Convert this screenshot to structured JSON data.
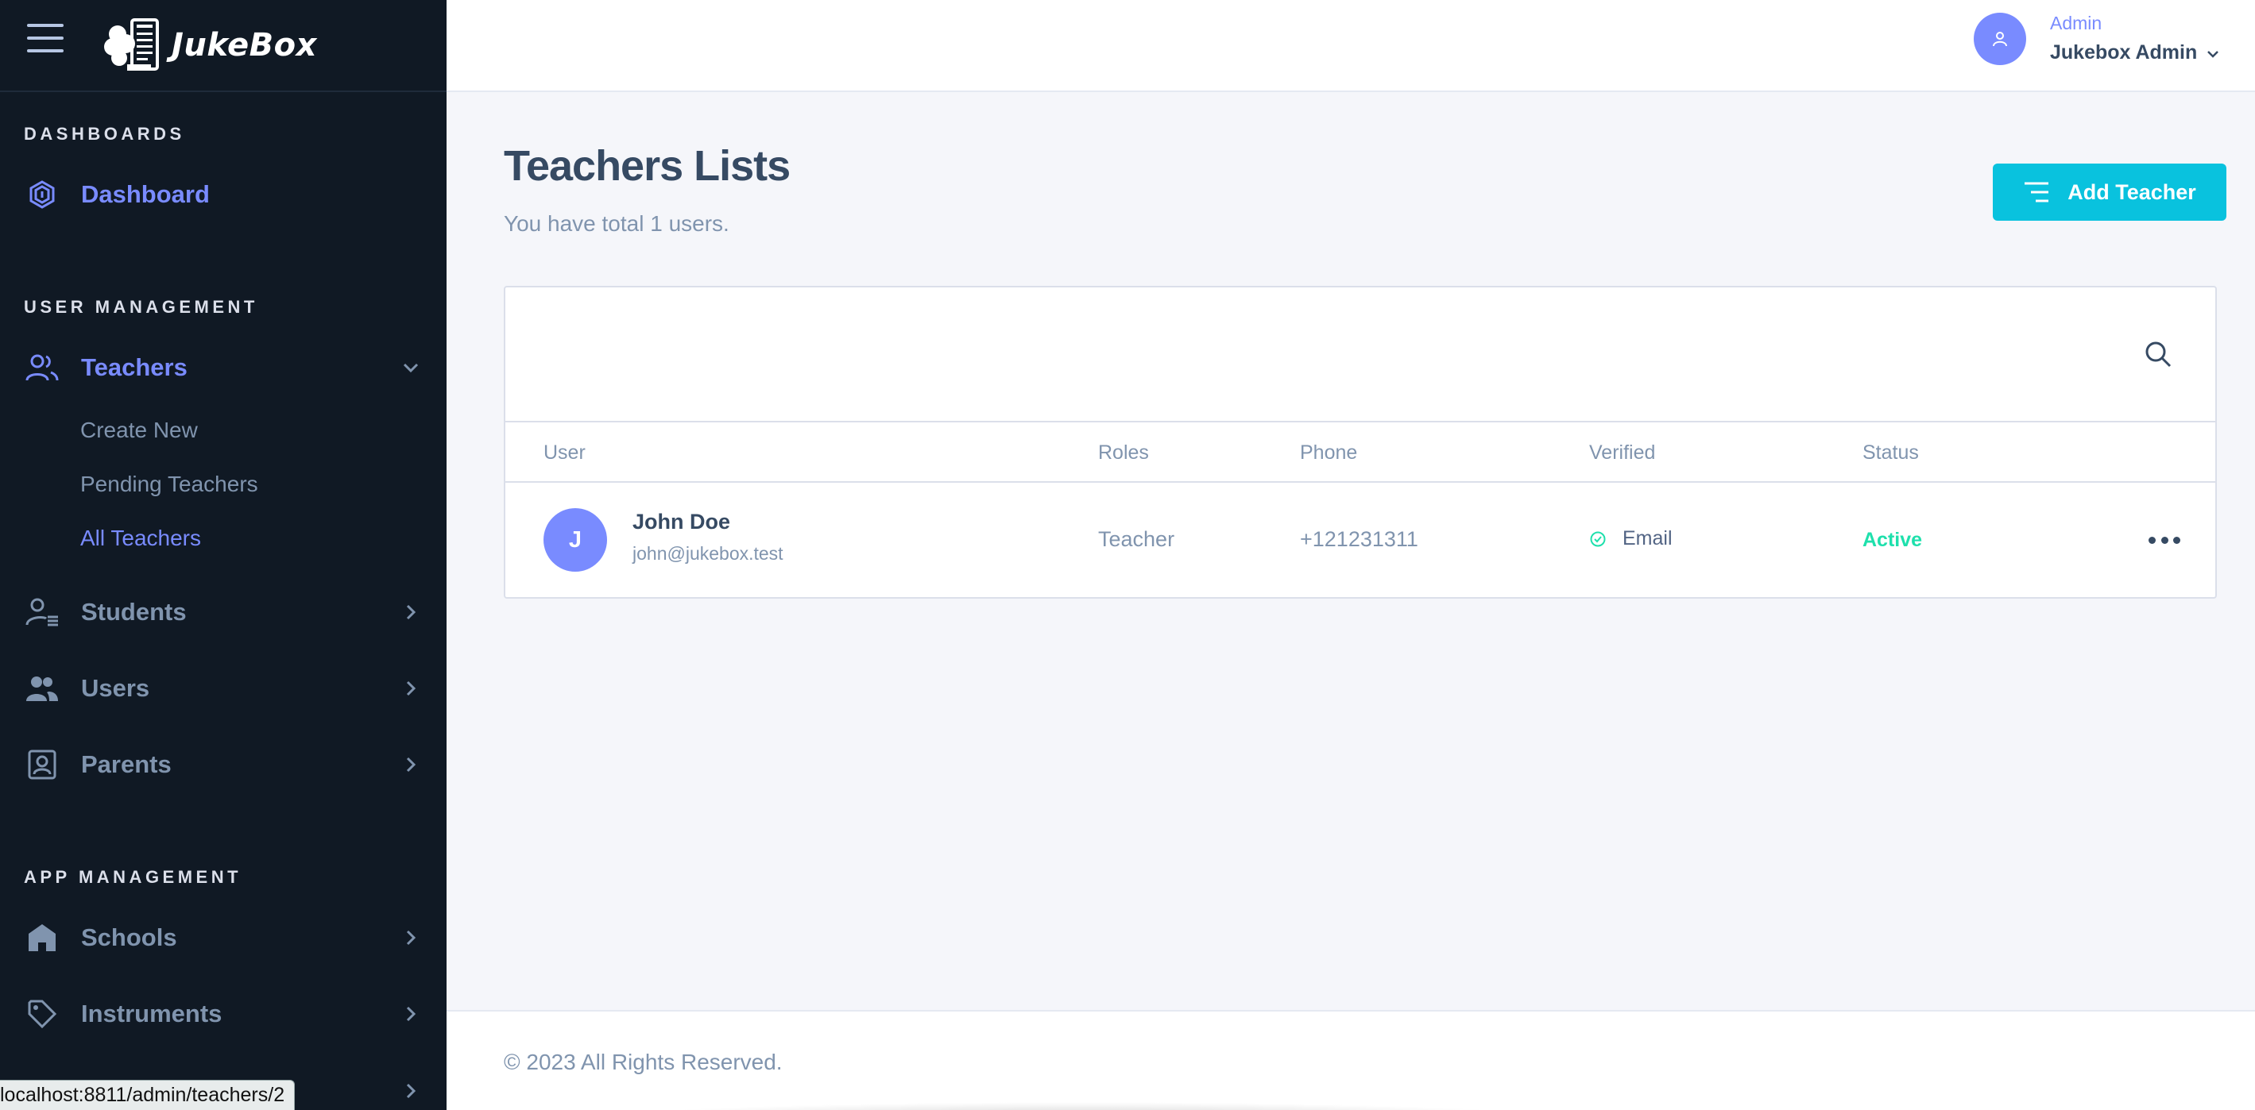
{
  "app": {
    "name": "JukeBox"
  },
  "sidebar": {
    "sections": [
      {
        "title": "DASHBOARDS"
      },
      {
        "title": "USER MANAGEMENT"
      },
      {
        "title": "APP MANAGEMENT"
      }
    ],
    "dashboard": {
      "label": "Dashboard",
      "icon": "dashboard-icon"
    },
    "teachers": {
      "label": "Teachers",
      "icon": "teachers-icon",
      "children": [
        {
          "label": "Create New"
        },
        {
          "label": "Pending Teachers"
        },
        {
          "label": "All Teachers"
        }
      ]
    },
    "students": {
      "label": "Students",
      "icon": "students-icon"
    },
    "users": {
      "label": "Users",
      "icon": "users-icon"
    },
    "parents": {
      "label": "Parents",
      "icon": "parents-icon"
    },
    "schools": {
      "label": "Schools",
      "icon": "school-icon"
    },
    "instruments": {
      "label": "Instruments",
      "icon": "tag-icon"
    }
  },
  "status_bar": {
    "url": "localhost:8811/admin/teachers/2"
  },
  "header": {
    "role": "Admin",
    "user_name": "Jukebox Admin"
  },
  "page": {
    "title": "Teachers Lists",
    "subtitle": "You have total 1 users.",
    "add_button": "Add Teacher"
  },
  "table": {
    "columns": [
      "User",
      "Roles",
      "Phone",
      "Verified",
      "Status"
    ],
    "rows": [
      {
        "initial": "J",
        "name": "John Doe",
        "email": "john@jukebox.test",
        "role": "Teacher",
        "phone": "+121231311",
        "verified": "Email",
        "status": "Active"
      }
    ]
  },
  "footer": {
    "text": "© 2023 All Rights Reserved."
  },
  "colors": {
    "sidebar_bg": "#101924",
    "accent": "#798bff",
    "primary_button": "#09c2de",
    "success": "#1ee0ac",
    "page_bg": "#f5f6fa"
  }
}
